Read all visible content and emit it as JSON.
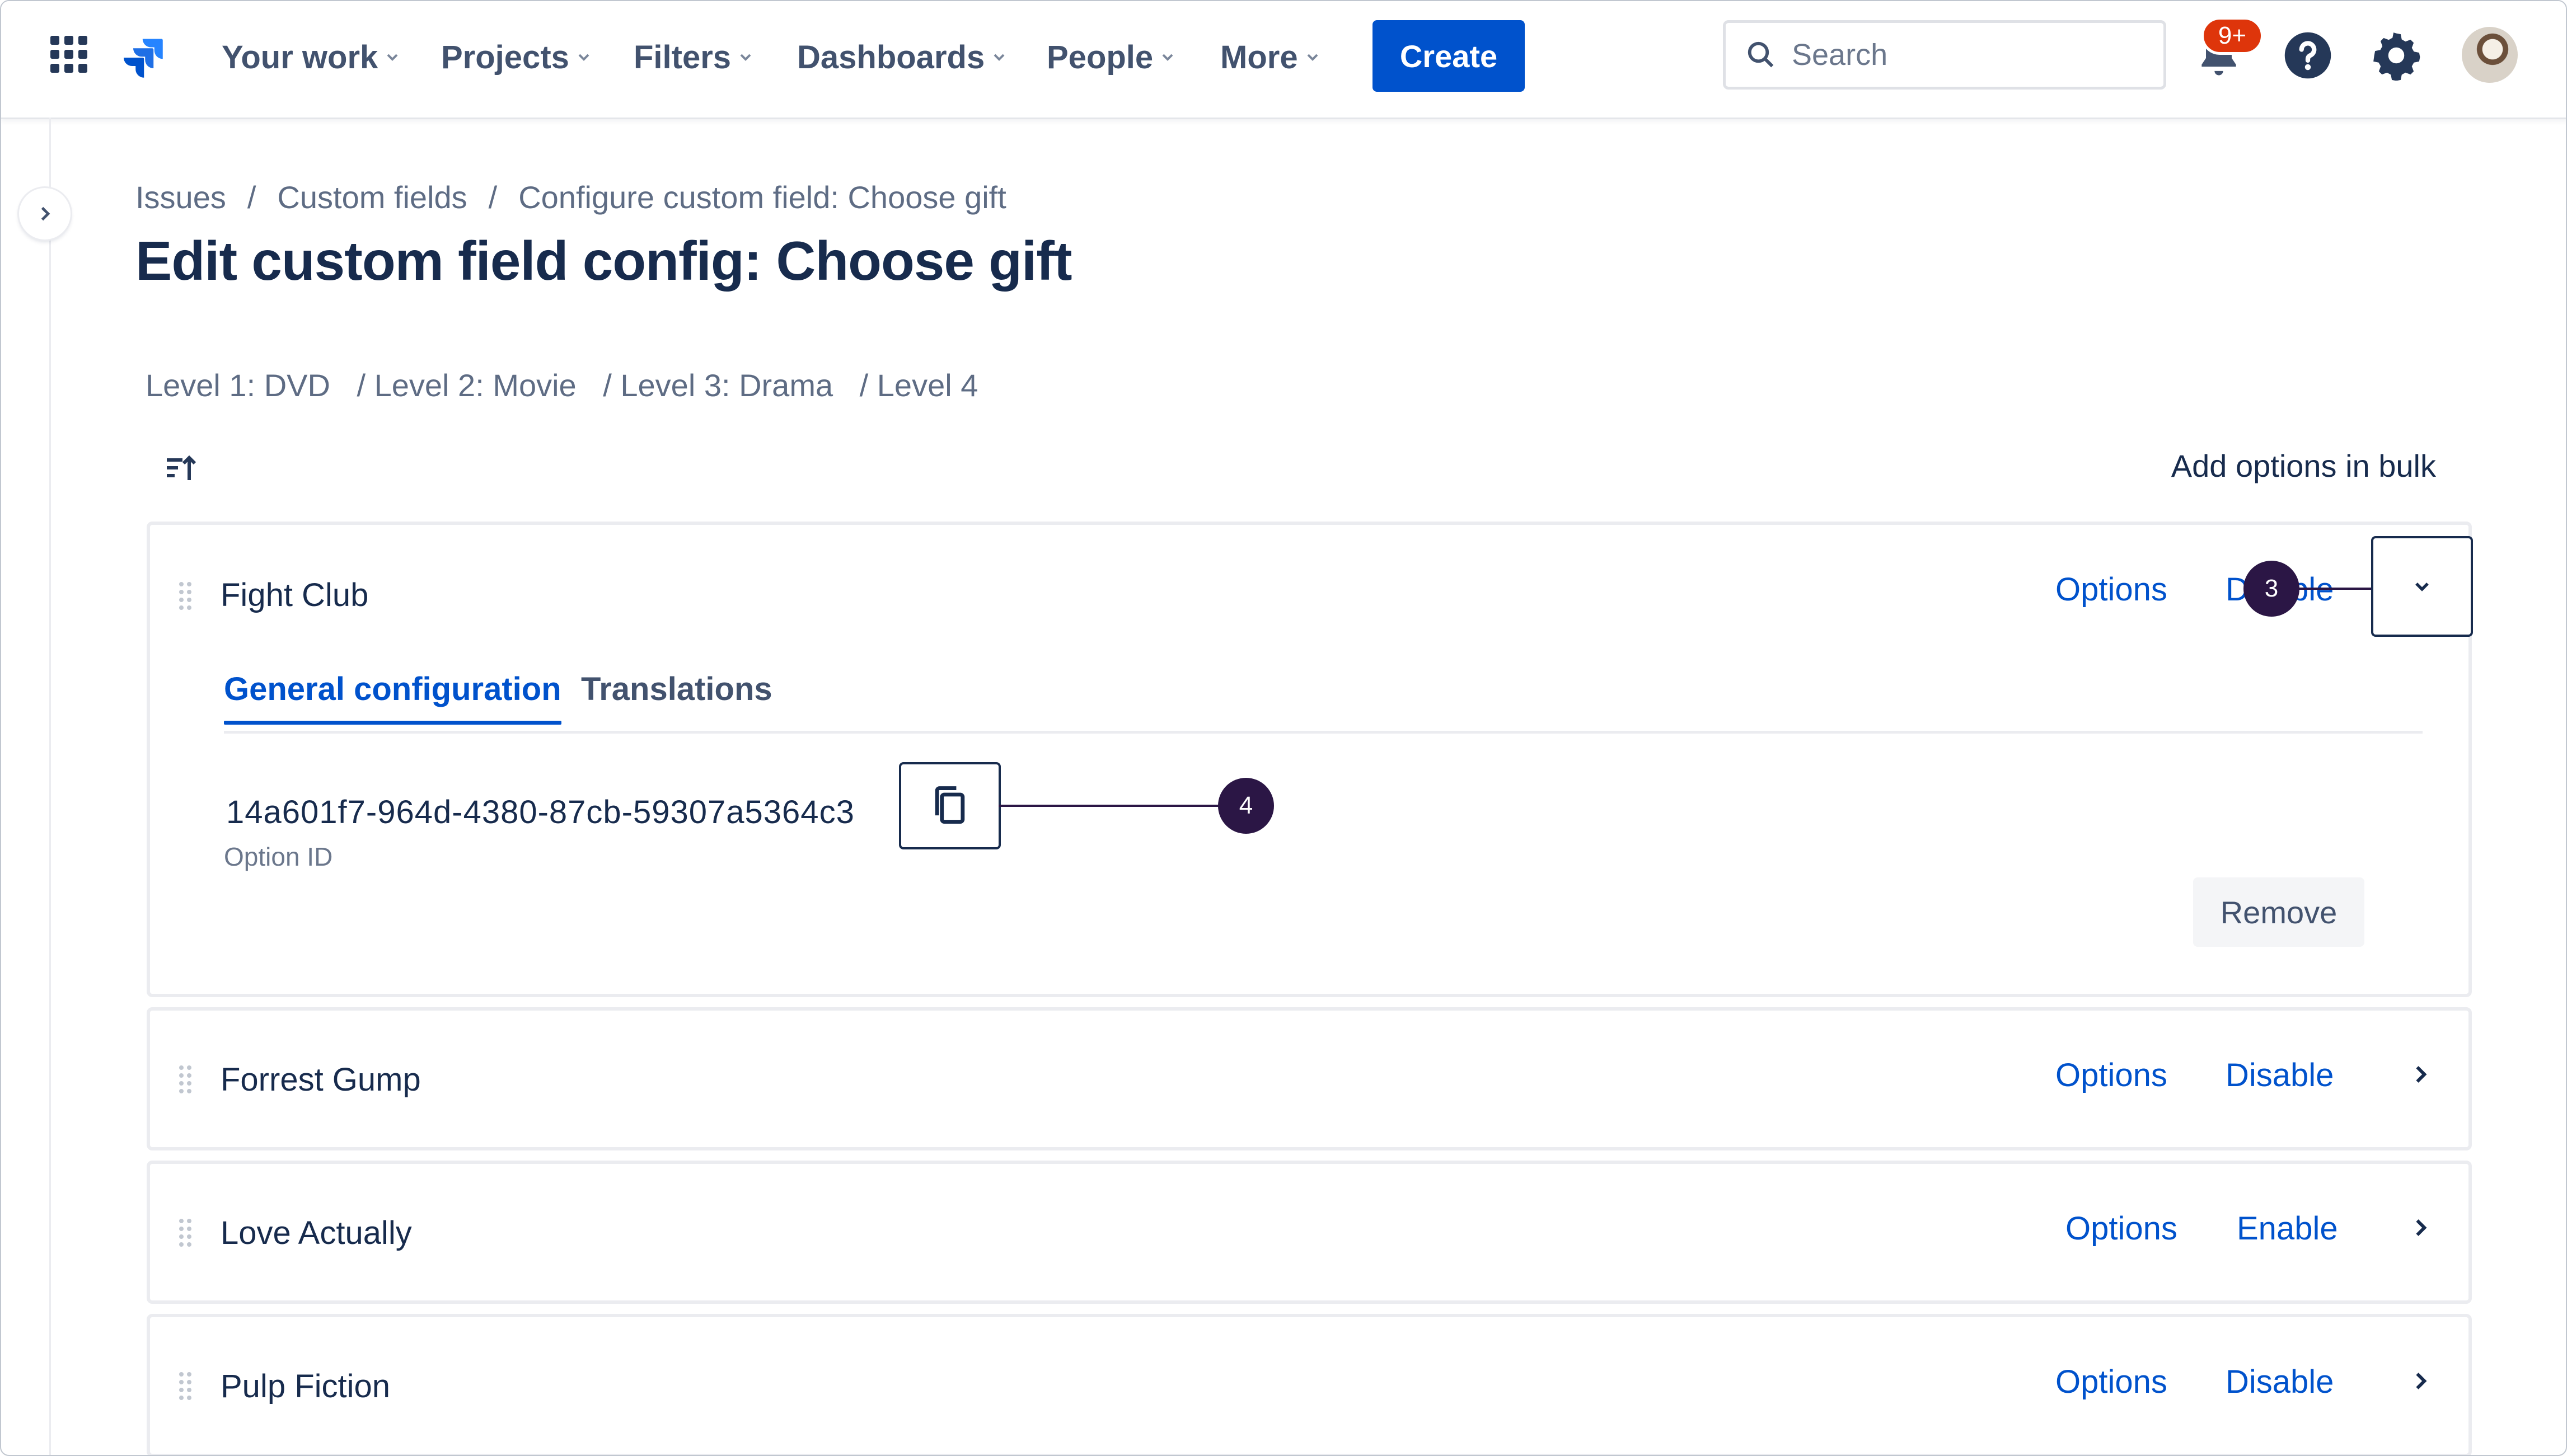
{
  "nav": {
    "items": [
      {
        "label": "Your work"
      },
      {
        "label": "Projects"
      },
      {
        "label": "Filters"
      },
      {
        "label": "Dashboards"
      },
      {
        "label": "People"
      },
      {
        "label": "More"
      }
    ],
    "create_label": "Create",
    "search_placeholder": "Search",
    "notifications_badge": "9+"
  },
  "breadcrumb": {
    "items": [
      "Issues",
      "Custom fields",
      "Configure custom field: Choose gift"
    ]
  },
  "page_title": "Edit custom field config: Choose gift",
  "levels": [
    "Level 1: DVD",
    "/ Level 2: Movie",
    "/ Level 3: Drama",
    "/ Level 4"
  ],
  "add_bulk_label": "Add options in bulk",
  "options": [
    {
      "name": "Fight Club",
      "options_label": "Options",
      "toggle_label": "Disable",
      "expanded": true
    },
    {
      "name": "Forrest Gump",
      "options_label": "Options",
      "toggle_label": "Disable",
      "expanded": false
    },
    {
      "name": "Love Actually",
      "options_label": "Options",
      "toggle_label": "Enable",
      "expanded": false
    },
    {
      "name": "Pulp Fiction",
      "options_label": "Options",
      "toggle_label": "Disable",
      "expanded": false
    }
  ],
  "expanded_panel": {
    "tabs": [
      "General configuration",
      "Translations"
    ],
    "active_tab": "General configuration",
    "option_id": "14a601f7-964d-4380-87cb-59307a5364c3",
    "option_id_label": "Option ID",
    "remove_label": "Remove"
  },
  "callouts": {
    "marker_3": "3",
    "marker_4": "4"
  },
  "colors": {
    "primary": "#0052cc",
    "text": "#172b4d",
    "marker": "#2b1645",
    "badge": "#de350b"
  },
  "icons": [
    "app-switcher-icon",
    "jira-logo-icon",
    "search-icon",
    "notification-icon",
    "help-icon",
    "settings-icon",
    "sort-icon",
    "drag-handle-icon",
    "copy-icon",
    "chevron-down-icon",
    "chevron-right-icon"
  ]
}
